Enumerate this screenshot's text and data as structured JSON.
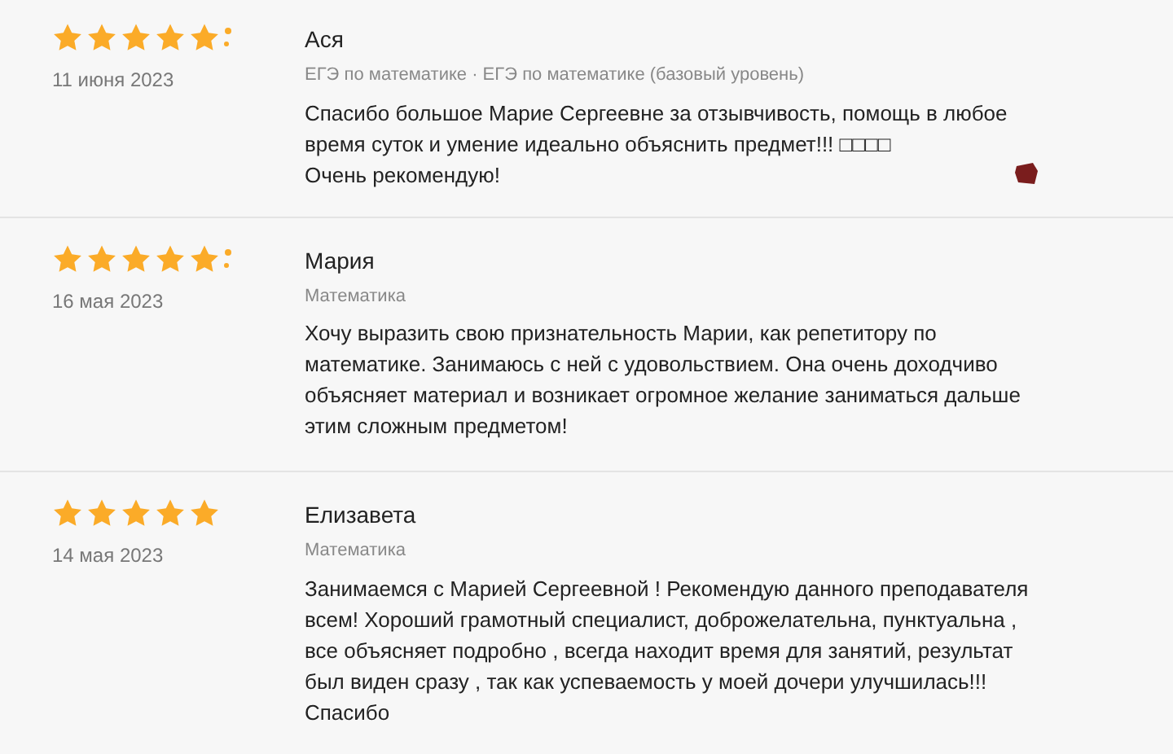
{
  "reviews": [
    {
      "stars": 5,
      "sparkle": true,
      "date": "11 июня 2023",
      "name": "Ася",
      "subject": "ЕГЭ по математике · ЕГЭ по математике (базовый уровень)",
      "lines": [
        "Спасибо большое Марие Сергеевне за отзывчивость, помощь в любое",
        "время суток и умение идеально объяснить предмет!!! □□□□",
        "Очень рекомендую!"
      ],
      "emoji": true
    },
    {
      "stars": 5,
      "sparkle": true,
      "date": "16 мая 2023",
      "name": "Мария",
      "subject": "Математика",
      "lines": [
        "Хочу выразить свою признательность Марии, как репетитору по",
        "математике. Занимаюсь с ней с удовольствием. Она очень доходчиво",
        "объясняет материал и возникает огромное желание заниматься дальше",
        "этим сложным предметом!"
      ],
      "emoji": false
    },
    {
      "stars": 5,
      "sparkle": false,
      "date": "14 мая 2023",
      "name": "Елизавета",
      "subject": "Математика",
      "lines": [
        "Занимаемся с Марией Сергеевной ! Рекомендую данного преподавателя",
        "всем! Хороший грамотный специалист, доброжелательна, пунктуальна ,",
        "все объясняет подробно , всегда находит время для занятий, результат",
        "был виден сразу , так как успеваемость у моей дочери улучшилась!!!",
        "Спасибо"
      ],
      "emoji": false
    }
  ]
}
